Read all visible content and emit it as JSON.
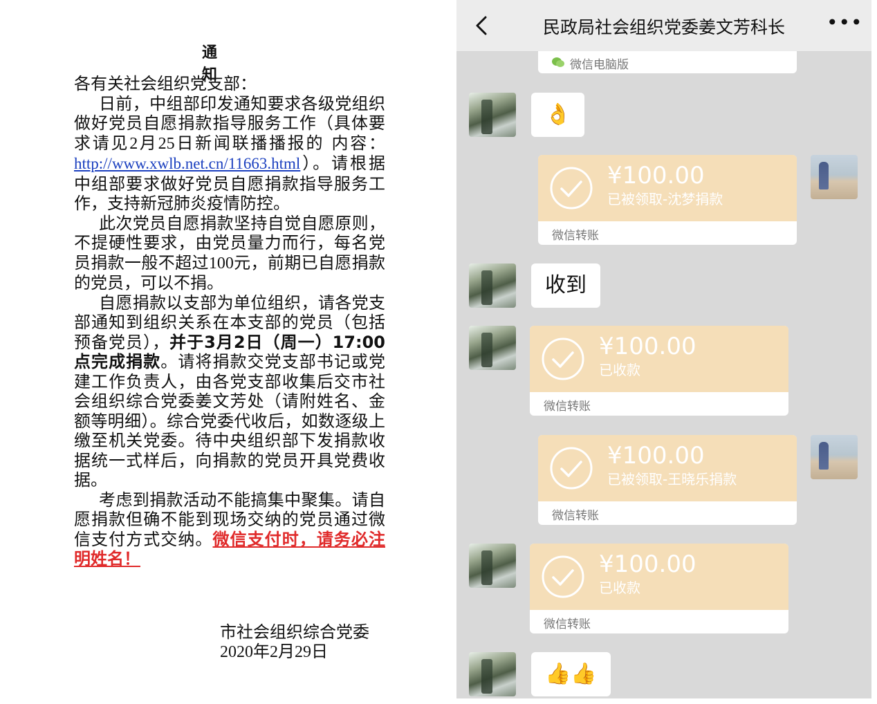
{
  "notice": {
    "title": "通 知",
    "greeting": "各有关社会组织党支部：",
    "p1_a": "日前，中组部印发通知要求各级党组织做好党员自愿捐款指导服务工作（具体要求请见",
    "p1_date": "2月25日",
    "p1_b": "新闻联播播报的 内容：",
    "p1_link": "http://www.xwlb.net.cn/11663.html",
    "p1_c": "）。请根据中组部要求做好党员自愿捐款指导服务工作，支持新冠肺炎疫情防控。",
    "p2_a": "此次党员自愿捐款坚持自觉自愿原则，不提硬性要求，由党员量力而行，每名党员捐款一般不超过",
    "p2_amount": "100",
    "p2_b": "元，前期已自愿捐款的党员，可以不捐。",
    "p3_a": "自愿捐款以支部为单位组织，请各党支部通知到组织关系在本支部的党员（包括预备党员），",
    "p3_bold": "并于3月2日（周一）17:00点完成捐款",
    "p3_b": "。请将捐款交党支部书记或党建工作负责人，由各党支部收集后交市社会组织综合党委姜文芳处（请附姓名、金额等明细）。综合党委代收后，如数逐级上缴至机关党委。待中央组织部下发捐款收据统一式样后，向捐款的党员开具党费收据。",
    "p4_a": "考虑到捐款活动不能搞集中聚集。请自愿捐款但确不能到现场交纳的党员通过微信支付方式交纳。",
    "p4_red": "微信支付时，请务必注明姓名！",
    "signer": "市社会组织综合党委",
    "date": "2020年2月29日"
  },
  "chat": {
    "title": "民政局社会组织党委姜文芳科长",
    "back_icon": "chevron-left-icon",
    "more_label": "•••",
    "pc_label": "微信电脑版",
    "msg_ok_emoji": "👌",
    "msg_received_text": "收到",
    "msg_thumbs_emoji": "👍👍",
    "transfer_footer": "微信转账",
    "transfers": [
      {
        "amount": "¥100.00",
        "status": "已被领取-沈梦捐款"
      },
      {
        "amount": "¥100.00",
        "status": "已收款"
      },
      {
        "amount": "¥100.00",
        "status": "已被领取-王晓乐捐款"
      },
      {
        "amount": "¥100.00",
        "status": "已收款"
      }
    ],
    "colors": {
      "background": "#d9d9d9",
      "transfer_card": "#f5deb8",
      "header": "#ececec"
    }
  }
}
